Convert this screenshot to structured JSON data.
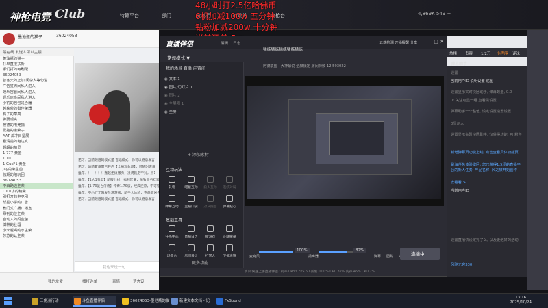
{
  "topbar": {
    "logo_line1": "神枪电竞",
    "logo_line2": "Club",
    "nav": [
      "特籁平台",
      "部门",
      "文艺行",
      "转动站",
      "攻枪台"
    ],
    "status_right": "4,869K  549 +"
  },
  "overlay_text": [
    "48小时打2.5亿哈佛币",
    "6机加减100w 五分钟",
    "钻粉加减200w 十分钟",
    "当前还差 5m"
  ],
  "room": {
    "name": "墨池瓶的猫子",
    "room_number": "36024053",
    "userlist_header": "最在线  发送人可以主接",
    "users": [
      "黄油瓶的猫子",
      "打早直接扶新",
      "哪们打的每刷配",
      "36024053",
      "昔客天的正加 闲杂人等勿进",
      "广告狂男间私人进入",
      "娱乐宫晋间私人进入",
      "娱乐店晚间私人进入",
      "小钓的包包是否器",
      "越获荣的键佳荣器",
      "石子的荤真",
      "佛要观实",
      "校德的电竞捕",
      "爱抱的淑荣子",
      "AAT 瓜冲目星展",
      "看清楚的电达真",
      "超超的精灵",
      "1  777  黄金",
      "1  10",
      "1  GusF1  黄金",
      "Jay的荣星菌",
      "独期的陪玩团",
      "36024053",
      "不由路边主荣",
      "LuLu坊的精荣",
      "别打开的电竞团",
      "帮星小学的广告",
      "教门式广播广播宣",
      "母刊的位主荣",
      "自动人的妈业菌",
      "博林的业器",
      "小宋越喝的水主荣",
      "苏苏的认主荣"
    ],
    "chat": [
      "诺可：当前频道的模式是 音话模式，你可以随意发言",
      "诺可：请前置设置已开启【全局现象场】，可随时客设",
      "推荐：！！！！！嘉起拓拨服务，没说就走不对，点1",
      "推荐：【1人1鬼型】新服上线，福利区满，精致业务欢迎",
      "推荐：【1.76复古传奇】传奇1.76版，经典还原，不可错过",
      "推荐：不约灯无限发放游游版，新手大体验，充单都送会",
      "诺可：当前频道的模式是 音话模式，你可以随意发言"
    ],
    "chat_placeholder": "我也来说一句",
    "bottom_buttons": [
      "我的友爱",
      "播打许单",
      "表情",
      "语言设"
    ]
  },
  "live": {
    "title": "直播伴侣",
    "mode": "常规模式 ▼",
    "tabs": [
      "编辑",
      "日志"
    ],
    "scene_header": "我的场景  直播  闲置间",
    "scenes": [
      "文本 1",
      "图片/幻灯片 1",
      "图片 2",
      "全屏剧 1",
      "全屏"
    ],
    "add_source": "+ 添加素材",
    "interact_header": "互动玩法",
    "interact_tools": [
      "礼物",
      "喵星互动",
      "投人互动",
      "连续对局",
      "弹幕互动",
      "主播口袋",
      "对决擂台",
      "弹幕贴心"
    ],
    "basic_header": "基础工具",
    "basic_tools": [
      "任务中心",
      "直播日历",
      "微游戏",
      "正聊撤录",
      "场景台",
      "房间设计",
      "打赏人",
      "下播清算"
    ],
    "more_tools": "更多功能",
    "preview_tabs": "猛练猛练猛练猛练猛练",
    "preview_subtabs": "阿德联盟 · 大神解说   全屏锁定   房间特效   12   593022",
    "top_right": "云端检测   开播提醒   分享",
    "sliders": [
      {
        "label": "麦克风",
        "pct": "100%",
        "value": 1.0
      },
      {
        "label": "扬声器",
        "pct": "82%",
        "value": 0.82
      }
    ],
    "bottom_icons": [
      "弹幕",
      "团购",
      "采集",
      "设置"
    ],
    "go_live": "连接中...",
    "status_line": "如何快速上手直播伴侣?   码率 0kb/s   FPS 60   丢帧 0.00%   CPU 32%   内存 45%   CPU 7%"
  },
  "assistant": {
    "tabs": [
      "热榜",
      "贵宾",
      "1/2万",
      "小程序",
      "评论"
    ],
    "title": "弹幕助手",
    "lines": [
      "设置",
      "当前用户ID   说明设置   贴图",
      "设置显示实时快团助手, 弹幕数量, 0.0",
      "0: 关注可显一组 直看需设置",
      "弹幕助手一个整值, 设定设置设置设置",
      "0显示人",
      "设置显示实时快团助手, 仅获得功能, 可 粉丝",
      "新增弹幕页功能上线, 点击查看具体功能页",
      "是海任务体验键区: 您已获得1.5场的直播平台的新人任务, 产品名称: 风之旅开始创作",
      "去看看 >",
      "当前用户ID",
      "设置直播快设定完了么, 以及更绝好的活动",
      "风驰无穷330"
    ]
  },
  "taskbar": {
    "items": [
      "三角洲行动",
      "斗鱼直播伴侣",
      "36024053-墨池瓶的猫",
      "新建文本文档 - 记事",
      "FxSound"
    ],
    "time": "13:16",
    "date": "2025/10/24"
  },
  "colors": {
    "overlay": "#ff2a2a",
    "accent": "#5aa0ff",
    "assist_orange": "#ff8c28"
  }
}
